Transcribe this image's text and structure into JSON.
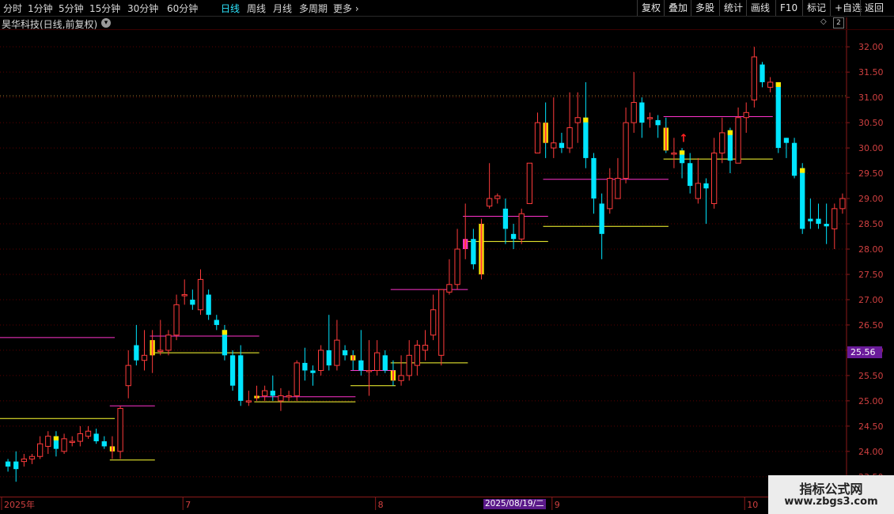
{
  "topbar": {
    "timeframes": [
      {
        "label": "分时",
        "active": false
      },
      {
        "label": "1分钟",
        "active": false
      },
      {
        "label": "5分钟",
        "active": false
      },
      {
        "label": "15分钟",
        "active": false
      },
      {
        "label": "30分钟",
        "active": false
      },
      {
        "label": "60分钟",
        "active": false
      },
      {
        "label": "日线",
        "active": true
      },
      {
        "label": "周线",
        "active": false
      },
      {
        "label": "月线",
        "active": false
      },
      {
        "label": "多周期",
        "active": false
      },
      {
        "label": "更多",
        "active": false
      }
    ],
    "more_chevron": "›",
    "buttons": [
      "复权",
      "叠加",
      "多股",
      "统计",
      "画线",
      "F10",
      "标记",
      "+自选",
      "返回"
    ]
  },
  "title": {
    "text": "昊华科技(日线,前复权)",
    "toggle_glyph": "▾"
  },
  "icons": {
    "diamond": "◇",
    "count_box": "2"
  },
  "price_tag": "25.56",
  "date_tag": "2025/08/19/二",
  "watermark": {
    "title": "指标公式网",
    "url": "www.zbgs3.com"
  },
  "chart_data": {
    "type": "candlestick",
    "ylim": [
      23.2,
      32.3
    ],
    "y_ticks": [
      "23.50",
      "24.00",
      "24.50",
      "25.00",
      "25.50",
      "26.00",
      "26.50",
      "27.00",
      "27.50",
      "28.00",
      "28.50",
      "29.00",
      "29.50",
      "30.00",
      "30.50",
      "31.00",
      "31.50",
      "32.00"
    ],
    "x_labels": [
      {
        "label": "2025年",
        "index": 0
      },
      {
        "label": "7",
        "index": 22
      },
      {
        "label": "8",
        "index": 46
      },
      {
        "label": "9",
        "index": 68
      },
      {
        "label": "10",
        "index": 92
      }
    ],
    "colors": {
      "up": "#ff3b3b",
      "down": "#00e5ff",
      "highlight_up": "#ffeb00",
      "magenta": "#ff33cc",
      "yellow": "#ffff33",
      "grid": "#5a0000"
    },
    "candles": [
      [
        23.8,
        23.7,
        23.85,
        23.6
      ],
      [
        23.8,
        23.65,
        24.0,
        23.4
      ],
      [
        23.8,
        23.85,
        23.95,
        23.7
      ],
      [
        23.85,
        23.9,
        23.95,
        23.75
      ],
      [
        23.9,
        24.15,
        24.3,
        23.85
      ],
      [
        24.1,
        24.3,
        24.4,
        23.95
      ],
      [
        24.3,
        24.05,
        24.4,
        23.9
      ],
      [
        24.0,
        24.25,
        24.35,
        23.95
      ],
      [
        24.2,
        24.2,
        24.3,
        24.1
      ],
      [
        24.2,
        24.35,
        24.5,
        24.1
      ],
      [
        24.3,
        24.4,
        24.5,
        24.25
      ],
      [
        24.35,
        24.2,
        24.45,
        24.15
      ],
      [
        24.2,
        24.1,
        24.3,
        24.05
      ],
      [
        24.0,
        24.1,
        24.3,
        23.85
      ],
      [
        24.0,
        24.85,
        24.9,
        23.85
      ],
      [
        25.3,
        25.7,
        26.0,
        25.05
      ],
      [
        26.1,
        25.8,
        26.5,
        25.7
      ],
      [
        25.8,
        25.9,
        26.4,
        25.6
      ],
      [
        25.9,
        26.2,
        26.4,
        25.55
      ],
      [
        26.0,
        26.0,
        26.6,
        25.9
      ],
      [
        26.0,
        26.3,
        26.4,
        25.9
      ],
      [
        26.3,
        26.9,
        27.1,
        26.2
      ],
      [
        27.1,
        27.1,
        27.4,
        26.9
      ],
      [
        27.0,
        26.9,
        27.2,
        26.8
      ],
      [
        26.8,
        27.4,
        27.6,
        26.7
      ],
      [
        27.1,
        26.7,
        27.2,
        26.6
      ],
      [
        26.6,
        26.5,
        26.7,
        26.4
      ],
      [
        26.4,
        25.9,
        26.5,
        25.8
      ],
      [
        25.9,
        25.3,
        26.0,
        25.2
      ],
      [
        25.9,
        25.0,
        26.1,
        24.9
      ],
      [
        25.0,
        25.0,
        25.2,
        24.9
      ],
      [
        25.05,
        25.1,
        25.3,
        25.0
      ],
      [
        25.1,
        25.2,
        25.3,
        25.0
      ],
      [
        25.2,
        25.1,
        25.5,
        25.0
      ],
      [
        25.0,
        25.1,
        25.25,
        24.8
      ],
      [
        25.1,
        25.1,
        25.2,
        25.0
      ],
      [
        25.1,
        25.75,
        25.8,
        25.0
      ],
      [
        25.75,
        25.6,
        26.05,
        25.4
      ],
      [
        25.6,
        25.55,
        25.7,
        25.3
      ],
      [
        25.6,
        26.0,
        26.1,
        25.5
      ],
      [
        26.0,
        25.7,
        26.7,
        25.6
      ],
      [
        25.7,
        26.2,
        26.6,
        25.6
      ],
      [
        26.0,
        25.9,
        26.1,
        25.8
      ],
      [
        25.9,
        25.8,
        26.0,
        25.6
      ],
      [
        25.8,
        25.6,
        26.4,
        25.5
      ],
      [
        25.6,
        25.6,
        26.2,
        25.1
      ],
      [
        25.6,
        25.95,
        26.2,
        25.5
      ],
      [
        25.9,
        25.6,
        26.0,
        25.55
      ],
      [
        25.6,
        25.4,
        25.8,
        25.3
      ],
      [
        25.4,
        25.5,
        25.9,
        25.3
      ],
      [
        25.5,
        25.9,
        26.2,
        25.4
      ],
      [
        25.7,
        26.1,
        26.2,
        25.5
      ],
      [
        26.0,
        26.1,
        26.4,
        25.8
      ],
      [
        26.3,
        26.8,
        27.1,
        26.2
      ],
      [
        25.9,
        27.2,
        27.2,
        25.7
      ],
      [
        27.15,
        27.3,
        27.8,
        27.1
      ],
      [
        27.3,
        28.0,
        28.4,
        27.2
      ],
      [
        28.0,
        28.2,
        28.9,
        27.8
      ],
      [
        28.2,
        27.7,
        28.4,
        27.6
      ],
      [
        27.5,
        28.5,
        28.6,
        27.4
      ],
      [
        28.85,
        29.0,
        29.7,
        28.8
      ],
      [
        29.0,
        29.05,
        29.1,
        28.9
      ],
      [
        28.8,
        28.4,
        29.0,
        28.1
      ],
      [
        28.3,
        28.2,
        28.5,
        28.0
      ],
      [
        28.2,
        28.7,
        28.8,
        28.1
      ],
      [
        28.9,
        29.7,
        29.7,
        28.9
      ],
      [
        29.9,
        30.5,
        30.7,
        29.9
      ],
      [
        30.5,
        30.1,
        30.9,
        29.8
      ],
      [
        30.0,
        30.1,
        31.0,
        29.8
      ],
      [
        30.1,
        30.0,
        30.3,
        29.9
      ],
      [
        30.0,
        30.4,
        31.1,
        29.9
      ],
      [
        30.5,
        30.6,
        31.1,
        30.1
      ],
      [
        30.6,
        29.8,
        31.3,
        29.6
      ],
      [
        29.8,
        29.0,
        29.9,
        28.7
      ],
      [
        28.9,
        28.3,
        29.1,
        27.8
      ],
      [
        28.8,
        29.4,
        29.6,
        28.7
      ],
      [
        29.0,
        29.4,
        29.8,
        29.0
      ],
      [
        29.4,
        30.5,
        30.8,
        29.3
      ],
      [
        30.5,
        30.9,
        31.5,
        30.3
      ],
      [
        30.9,
        30.5,
        31.0,
        30.2
      ],
      [
        30.6,
        30.6,
        30.7,
        30.4
      ],
      [
        30.55,
        30.45,
        30.65,
        30.2
      ],
      [
        30.4,
        29.95,
        30.6,
        29.9
      ],
      [
        29.9,
        29.9,
        30.2,
        29.6
      ],
      [
        29.95,
        29.7,
        30.0,
        29.4
      ],
      [
        29.7,
        29.25,
        29.9,
        29.1
      ],
      [
        29.0,
        29.3,
        29.8,
        28.9
      ],
      [
        29.3,
        29.2,
        29.4,
        28.5
      ],
      [
        28.9,
        29.9,
        30.2,
        28.8
      ],
      [
        29.9,
        30.3,
        30.6,
        29.7
      ],
      [
        30.35,
        29.75,
        30.4,
        29.5
      ],
      [
        29.7,
        30.6,
        30.8,
        29.7
      ],
      [
        30.6,
        30.7,
        30.9,
        30.3
      ],
      [
        30.95,
        31.8,
        32.0,
        30.8
      ],
      [
        31.65,
        31.3,
        31.7,
        31.2
      ],
      [
        31.2,
        31.3,
        31.4,
        31.1
      ],
      [
        31.3,
        30.0,
        31.3,
        29.9
      ],
      [
        30.2,
        30.1,
        30.2,
        29.8
      ],
      [
        30.1,
        29.45,
        30.2,
        29.4
      ],
      [
        29.6,
        28.4,
        29.7,
        28.3
      ],
      [
        28.6,
        28.55,
        29.0,
        28.4
      ],
      [
        28.6,
        28.5,
        28.9,
        28.4
      ],
      [
        28.5,
        28.45,
        28.9,
        28.1
      ],
      [
        28.4,
        28.8,
        28.9,
        28.0
      ],
      [
        28.8,
        29.0,
        29.1,
        28.7
      ]
    ],
    "reference_lines": [
      {
        "color": "magenta",
        "price": 26.25,
        "from": 0,
        "to": 13
      },
      {
        "color": "yellow",
        "price": 24.65,
        "from": 0,
        "to": 13
      },
      {
        "color": "magenta",
        "price": 24.9,
        "from": 13,
        "to": 18
      },
      {
        "color": "yellow",
        "price": 23.83,
        "from": 13,
        "to": 18
      },
      {
        "color": "magenta",
        "price": 26.28,
        "from": 18,
        "to": 31
      },
      {
        "color": "yellow",
        "price": 25.95,
        "from": 18,
        "to": 31
      },
      {
        "color": "magenta",
        "price": 25.08,
        "from": 31,
        "to": 43
      },
      {
        "color": "yellow",
        "price": 24.98,
        "from": 31,
        "to": 43
      },
      {
        "color": "magenta",
        "price": 25.6,
        "from": 43,
        "to": 48
      },
      {
        "color": "yellow",
        "price": 25.3,
        "from": 43,
        "to": 48
      },
      {
        "color": "magenta",
        "price": 27.2,
        "from": 48,
        "to": 57
      },
      {
        "color": "yellow",
        "price": 25.75,
        "from": 48,
        "to": 57
      },
      {
        "color": "magenta",
        "price": 28.65,
        "from": 57,
        "to": 67
      },
      {
        "color": "yellow",
        "price": 28.15,
        "from": 57,
        "to": 67
      },
      {
        "color": "magenta",
        "price": 29.38,
        "from": 67,
        "to": 82
      },
      {
        "color": "yellow",
        "price": 28.45,
        "from": 67,
        "to": 82
      },
      {
        "color": "magenta",
        "price": 30.62,
        "from": 82,
        "to": 95
      },
      {
        "color": "yellow",
        "price": 29.78,
        "from": 82,
        "to": 95
      }
    ],
    "special_candles": [
      {
        "index": 13,
        "style": "striped"
      },
      {
        "index": 18,
        "style": "striped"
      },
      {
        "index": 31,
        "style": "striped"
      },
      {
        "index": 43,
        "style": "striped"
      },
      {
        "index": 48,
        "style": "striped"
      },
      {
        "index": 57,
        "style": "magenta-striped"
      },
      {
        "index": 59,
        "style": "striped"
      },
      {
        "index": 67,
        "style": "striped"
      },
      {
        "index": 82,
        "style": "striped"
      }
    ],
    "arrow_marker": {
      "index": 84,
      "price": 30.2,
      "glyph": "↑"
    }
  }
}
